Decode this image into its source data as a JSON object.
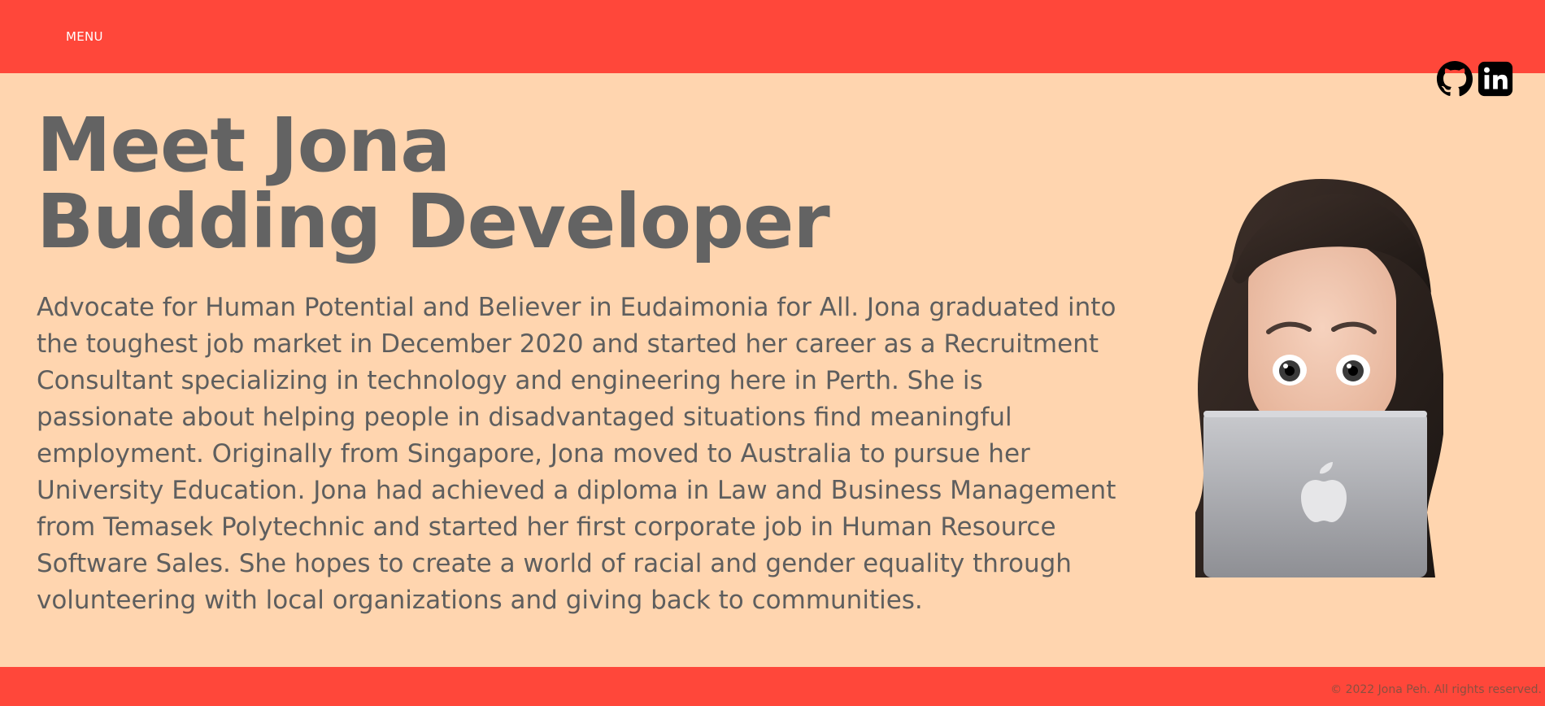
{
  "header": {
    "menu_label": "MENU"
  },
  "social": [
    {
      "icon": "github-icon",
      "label": "GitHub"
    },
    {
      "icon": "linkedin-icon",
      "label": "LinkedIn"
    }
  ],
  "hero": {
    "title_line1": "Meet Jona",
    "title_line2": "Budding Developer",
    "bio": "Advocate for Human Potential and Believer in Eudaimonia for All. Jona graduated into the toughest job market in December 2020 and started her career as a Recruitment Consultant specializing in technology and engineering here in Perth. She is passionate about helping people in disadvantaged situations find meaningful employment. Originally from Singapore, Jona moved to Australia to pursue her University Education. Jona had achieved a diploma in Law and Business Management from Temasek Polytechnic and started her first corporate job in Human Resource Software Sales. She hopes to create a world of racial and gender equality through volunteering with local organizations and giving back to communities."
  },
  "footer": {
    "copyright": "© 2022 Jona Peh. All rights reserved."
  },
  "colors": {
    "bar": "#FF473A",
    "background": "#FFD5AF",
    "text": "#636363"
  }
}
